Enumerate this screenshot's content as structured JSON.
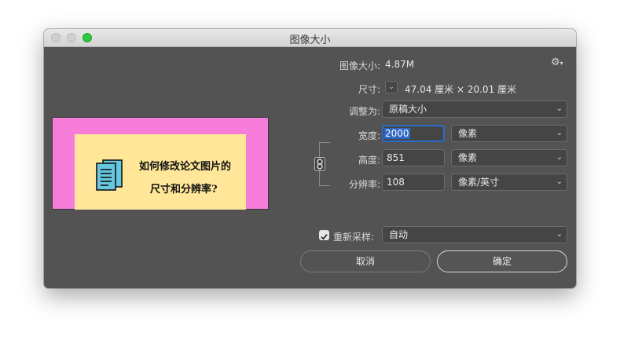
{
  "window": {
    "title": "图像大小"
  },
  "preview": {
    "line1": "如何修改论文图片的",
    "line2": "尺寸和分辨率?"
  },
  "image_size": {
    "label": "图像大小:",
    "value": "4.87M"
  },
  "dimensions": {
    "label": "尺寸:",
    "value": "47.04 厘米  ×  20.01 厘米"
  },
  "fit_to": {
    "label": "调整为:",
    "value": "原稿大小"
  },
  "width": {
    "label": "宽度:",
    "value": "2000",
    "unit": "像素"
  },
  "height": {
    "label": "高度:",
    "value": "851",
    "unit": "像素"
  },
  "resolution": {
    "label": "分辨率:",
    "value": "108",
    "unit": "像素/英寸"
  },
  "resample": {
    "label": "重新采样:",
    "checked": true,
    "value": "自动"
  },
  "buttons": {
    "cancel": "取消",
    "ok": "确定"
  },
  "icons": {
    "settings": "gear-icon",
    "link": "link-icon",
    "dropdown": "chevron-down-icon",
    "document": "document-icon"
  },
  "colors": {
    "dialog_bg": "#535353",
    "preview_outer": "#f77ddb",
    "preview_inner": "#ffe699",
    "focus": "#2d6ccd",
    "maximize": "#2bc840"
  }
}
